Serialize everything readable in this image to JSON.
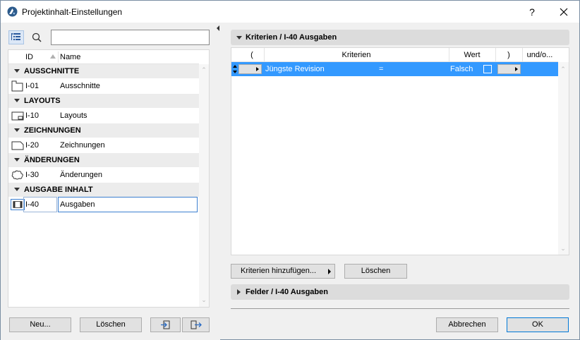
{
  "window": {
    "title": "Projektinhalt-Einstellungen",
    "help_label": "?",
    "icon": "archicad-app-icon"
  },
  "left": {
    "search": {
      "value": "",
      "placeholder": ""
    },
    "columns": {
      "id": "ID",
      "name": "Name"
    },
    "groups": [
      {
        "label": "AUSSCHNITTE",
        "item": {
          "id": "I-01",
          "name": "Ausschnitte",
          "icon": "view-icon"
        }
      },
      {
        "label": "LAYOUTS",
        "item": {
          "id": "I-10",
          "name": "Layouts",
          "icon": "layout-icon"
        }
      },
      {
        "label": "ZEICHNUNGEN",
        "item": {
          "id": "I-20",
          "name": "Zeichnungen",
          "icon": "drawing-icon"
        }
      },
      {
        "label": "ÄNDERUNGEN",
        "item": {
          "id": "I-30",
          "name": "Änderungen",
          "icon": "change-cloud-icon"
        }
      },
      {
        "label": "AUSGABE INHALT",
        "item": {
          "id": "I-40",
          "name": "Ausgaben",
          "icon": "issue-icon",
          "selected": true
        }
      }
    ],
    "buttons": {
      "new": "Neu...",
      "delete": "Löschen",
      "import": "import-icon",
      "export": "export-icon"
    }
  },
  "criteria": {
    "header": "Kriterien / I-40 Ausgaben",
    "columns": [
      "(",
      "Kriterien",
      "Wert",
      ")",
      "und/o..."
    ],
    "rows": [
      {
        "open_paren": "",
        "criterion": "Jüngste Revision",
        "operator": "=",
        "value": "Falsch",
        "checked": false,
        "close_paren": "",
        "logic": ""
      }
    ],
    "add_button": "Kriterien hinzufügen...",
    "delete_button": "Löschen"
  },
  "fields": {
    "header": "Felder / I-40 Ausgaben"
  },
  "footer": {
    "cancel": "Abbrechen",
    "ok": "OK"
  },
  "colors": {
    "selection": "#3399ff",
    "primary_border": "#0078d7",
    "section_bg": "#dcdcdc"
  }
}
